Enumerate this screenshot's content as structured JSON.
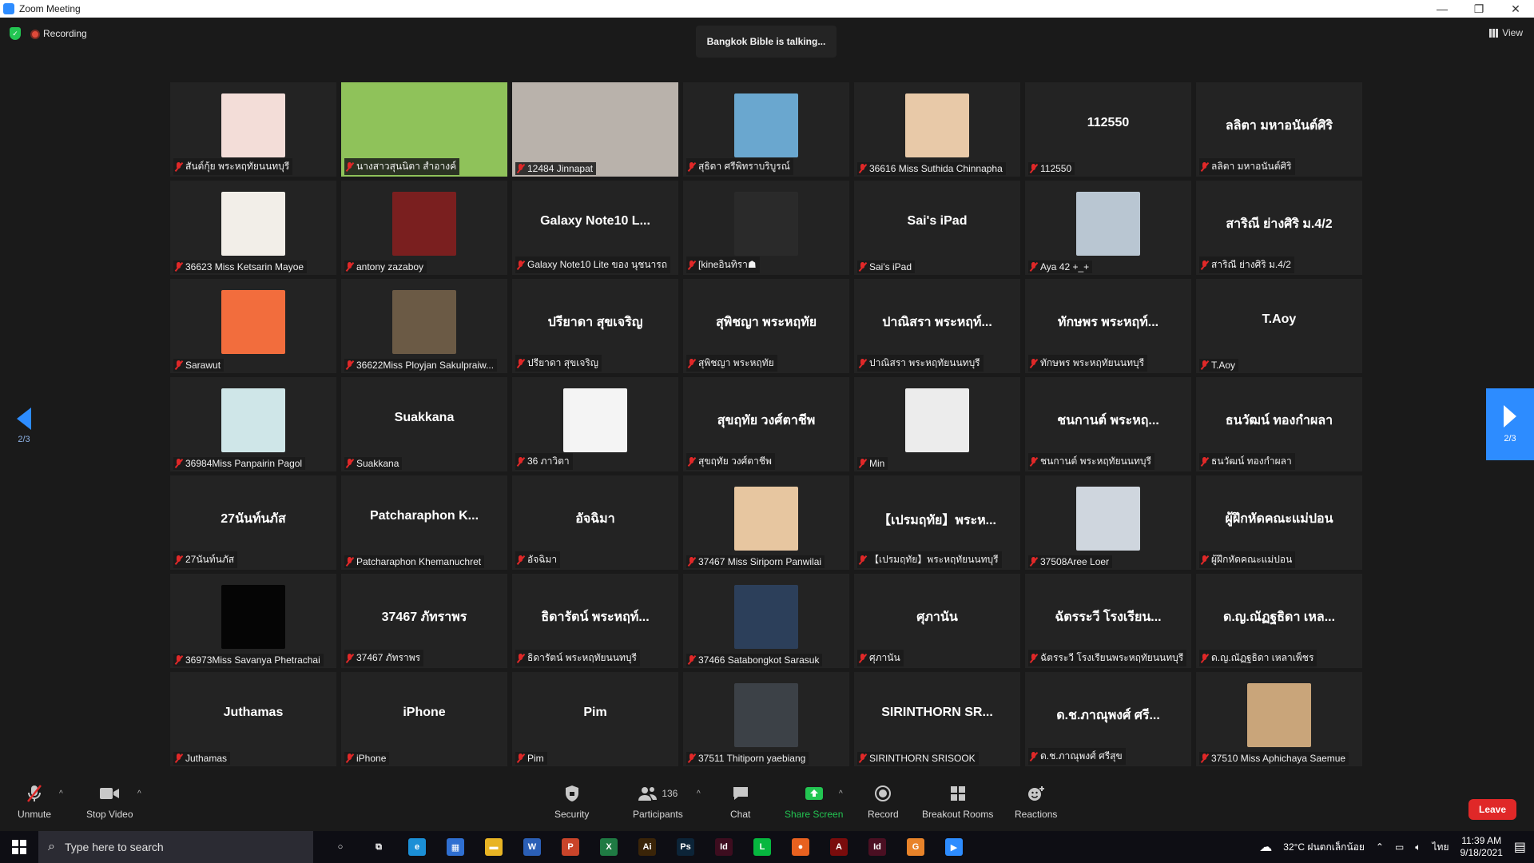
{
  "window": {
    "title": "Zoom Meeting",
    "minimize": "—",
    "restore": "❐",
    "close": "✕"
  },
  "meeting": {
    "recording_label": "Recording",
    "talking": "Bangkok Bible is talking...",
    "view_label": "View",
    "page_indicator": "2/3"
  },
  "tiles": [
    {
      "big": "",
      "label": "สันต์กุ้ย พระหฤทัยนนทบุรี",
      "kind": "avatar",
      "color": "#f3ddd8"
    },
    {
      "big": "",
      "label": "นางสาวสุนนิตา สำอางค์",
      "kind": "video",
      "color": "#8fc25a"
    },
    {
      "big": "",
      "label": "12484 Jinnapat",
      "kind": "video",
      "color": "#b9b2ab"
    },
    {
      "big": "",
      "label": "สุธิดา ศรีพิทราบริบูรณ์",
      "kind": "avatar",
      "color": "#6aa7cf"
    },
    {
      "big": "",
      "label": "36616 Miss Suthida Chinnapha",
      "kind": "avatar",
      "color": "#e8c9a8"
    },
    {
      "big": "112550",
      "label": "112550",
      "kind": "name",
      "color": ""
    },
    {
      "big": "ลลิตา มหาอนันต์ศิริ",
      "label": "ลลิตา มหาอนันต์ศิริ",
      "kind": "name",
      "color": ""
    },
    {
      "big": "",
      "label": "36623 Miss Ketsarin Mayoe",
      "kind": "avatar",
      "color": "#f2eee8"
    },
    {
      "big": "",
      "label": "antony zazaboy",
      "kind": "avatar",
      "color": "#7a1f1f"
    },
    {
      "big": "Galaxy Note10 L...",
      "label": "Galaxy Note10 Lite ของ นุชนารถ",
      "kind": "name",
      "color": ""
    },
    {
      "big": "",
      "label": "[kineอินทิรา☗",
      "kind": "avatar",
      "color": "#2a2a2a"
    },
    {
      "big": "Sai's iPad",
      "label": "Sai's iPad",
      "kind": "name",
      "color": ""
    },
    {
      "big": "",
      "label": "Aya 42 +_+",
      "kind": "avatar",
      "color": "#b9c6d2"
    },
    {
      "big": "สาริณี ย่างศิริ ม.4/2",
      "label": "สาริณี ย่างศิริ ม.4/2",
      "kind": "name",
      "color": ""
    },
    {
      "big": "",
      "label": "Sarawut",
      "kind": "avatar",
      "color": "#f26d3d"
    },
    {
      "big": "",
      "label": "36622Miss Ployjan Sakulpraiw...",
      "kind": "avatar",
      "color": "#6b5a45"
    },
    {
      "big": "ปรียาดา สุขเจริญ",
      "label": "ปรียาดา สุขเจริญ",
      "kind": "name",
      "color": ""
    },
    {
      "big": "สุพิชญา พระหฤทัย",
      "label": "สุพิชญา พระหฤทัย",
      "kind": "name",
      "color": ""
    },
    {
      "big": "ปาณิสรา พระหฤท์...",
      "label": "ปาณิสรา พระหฤทัยนนทบุรี",
      "kind": "name",
      "color": ""
    },
    {
      "big": "ทักษพร พระหฤท์...",
      "label": "ทักษพร พระหฤทัยนนทบุรี",
      "kind": "name",
      "color": ""
    },
    {
      "big": "T.Aoy",
      "label": "T.Aoy",
      "kind": "name",
      "color": ""
    },
    {
      "big": "",
      "label": "36984Miss Panpairin Pagol",
      "kind": "avatar",
      "color": "#cfe6e8"
    },
    {
      "big": "Suakkana",
      "label": "Suakkana",
      "kind": "name",
      "color": ""
    },
    {
      "big": "",
      "label": "36 ภาวิตา",
      "kind": "avatar",
      "color": "#f4f4f4"
    },
    {
      "big": "สุขฤทัย วงศ์ตาชีพ",
      "label": "สุขฤทัย วงศ์ตาชีพ",
      "kind": "name",
      "color": ""
    },
    {
      "big": "",
      "label": "Min",
      "kind": "avatar",
      "color": "#ececec"
    },
    {
      "big": "ชนกานต์ พระหฤ...",
      "label": "ชนกานต์ พระหฤทัยนนทบุรี",
      "kind": "name",
      "color": ""
    },
    {
      "big": "ธนวัฒน์ ทองกำผลา",
      "label": "ธนวัฒน์ ทองกำผลา",
      "kind": "name",
      "color": ""
    },
    {
      "big": "27นันท์นภัส",
      "label": "27นันท์นภัส",
      "kind": "name",
      "color": ""
    },
    {
      "big": "Patcharaphon K...",
      "label": "Patcharaphon Khemanuchret",
      "kind": "name",
      "color": ""
    },
    {
      "big": "อัจฉิมา",
      "label": "อัจฉิมา",
      "kind": "name",
      "color": ""
    },
    {
      "big": "",
      "label": "37467 Miss Siriporn Panwilai",
      "kind": "avatar",
      "color": "#e7c6a0"
    },
    {
      "big": "【เปรมฤทัย】พระห...",
      "label": "【เปรมฤทัย】พระหฤทัยนนทบุรี",
      "kind": "name",
      "color": ""
    },
    {
      "big": "",
      "label": "37508Aree Loer",
      "kind": "avatar",
      "color": "#cfd6de"
    },
    {
      "big": "ผู้ฝึกหัดคณะแม่ปอน",
      "label": "ผู้ฝึกหัดคณะแม่ปอน",
      "kind": "name",
      "color": ""
    },
    {
      "big": "",
      "label": "36973Miss Savanya Phetrachai",
      "kind": "avatar",
      "color": "#050505"
    },
    {
      "big": "37467 ภัทราพร",
      "label": "37467 ภัทราพร",
      "kind": "name",
      "color": ""
    },
    {
      "big": "ธิดารัตน์ พระหฤท์...",
      "label": "ธิดารัตน์ พระหฤทัยนนทบุรี",
      "kind": "name",
      "color": ""
    },
    {
      "big": "",
      "label": "37466 Satabongkot Sarasuk",
      "kind": "avatar",
      "color": "#2c3f5a"
    },
    {
      "big": "ศุภานัน",
      "label": "ศุภานัน",
      "kind": "name",
      "color": ""
    },
    {
      "big": "ฉัตรระวี โรงเรียน...",
      "label": "ฉัตรระวี โรงเรียนพระหฤทัยนนทบุรี",
      "kind": "name",
      "color": ""
    },
    {
      "big": "ด.ญ.ณัฏฐธิดา เหล...",
      "label": "ด.ญ.ณัฏฐธิดา เหลาเพ็ชร",
      "kind": "name",
      "color": ""
    },
    {
      "big": "Juthamas",
      "label": "Juthamas",
      "kind": "name",
      "color": ""
    },
    {
      "big": "iPhone",
      "label": "iPhone",
      "kind": "name",
      "color": ""
    },
    {
      "big": "Pim",
      "label": "Pim",
      "kind": "name",
      "color": ""
    },
    {
      "big": "",
      "label": "37511 Thitiporn yaebiang",
      "kind": "avatar",
      "color": "#3c4147"
    },
    {
      "big": "SIRINTHORN SR...",
      "label": "SIRINTHORN SRISOOK",
      "kind": "name",
      "color": ""
    },
    {
      "big": "ด.ช.ภาณุพงศ์ ศรี...",
      "label": "ด.ช.ภาณุพงศ์ ศรีสุข",
      "kind": "name",
      "color": ""
    },
    {
      "big": "",
      "label": "37510 Miss Aphichaya Saemue",
      "kind": "avatar",
      "color": "#c9a57a"
    }
  ],
  "toolbar": {
    "unmute": "Unmute",
    "stop_video": "Stop Video",
    "security": "Security",
    "participants": "Participants",
    "participants_count": "136",
    "chat": "Chat",
    "share_screen": "Share Screen",
    "record": "Record",
    "breakout_rooms": "Breakout Rooms",
    "reactions": "Reactions",
    "leave": "Leave",
    "share_color": "#23c552",
    "leave_color": "#e02828"
  },
  "taskbar": {
    "search_placeholder": "Type here to search",
    "weather": "32°C  ฝนตกเล็กน้อย",
    "lang": "ไทย",
    "time": "11:39 AM",
    "date": "9/18/2021",
    "apps": [
      {
        "name": "cortana-icon",
        "glyph": "○",
        "color": "transparent"
      },
      {
        "name": "task-view-icon",
        "glyph": "⧉",
        "color": "transparent"
      },
      {
        "name": "edge-icon",
        "glyph": "e",
        "color": "#1b8fd6"
      },
      {
        "name": "calculator-icon",
        "glyph": "▦",
        "color": "#2f6fd1"
      },
      {
        "name": "file-explorer-icon",
        "glyph": "▬",
        "color": "#e8b424"
      },
      {
        "name": "word-icon",
        "glyph": "W",
        "color": "#2b5fb6"
      },
      {
        "name": "powerpoint-icon",
        "glyph": "P",
        "color": "#c9442a"
      },
      {
        "name": "excel-icon",
        "glyph": "X",
        "color": "#1f7a43"
      },
      {
        "name": "illustrator-icon",
        "glyph": "Ai",
        "color": "#3a2408"
      },
      {
        "name": "photoshop-icon",
        "glyph": "Ps",
        "color": "#0c2438"
      },
      {
        "name": "indesign-icon",
        "glyph": "Id",
        "color": "#3d0d1f"
      },
      {
        "name": "line-icon",
        "glyph": "L",
        "color": "#06b73f"
      },
      {
        "name": "firefox-icon",
        "glyph": "●",
        "color": "#e8611f"
      },
      {
        "name": "acrobat-icon",
        "glyph": "A",
        "color": "#7a0c0c"
      },
      {
        "name": "indesign2-icon",
        "glyph": "Id",
        "color": "#4a0f22"
      },
      {
        "name": "grammarly-icon",
        "glyph": "G",
        "color": "#e8832a"
      },
      {
        "name": "zoom-taskbar-icon",
        "glyph": "▶",
        "color": "#2d8cff"
      }
    ]
  }
}
